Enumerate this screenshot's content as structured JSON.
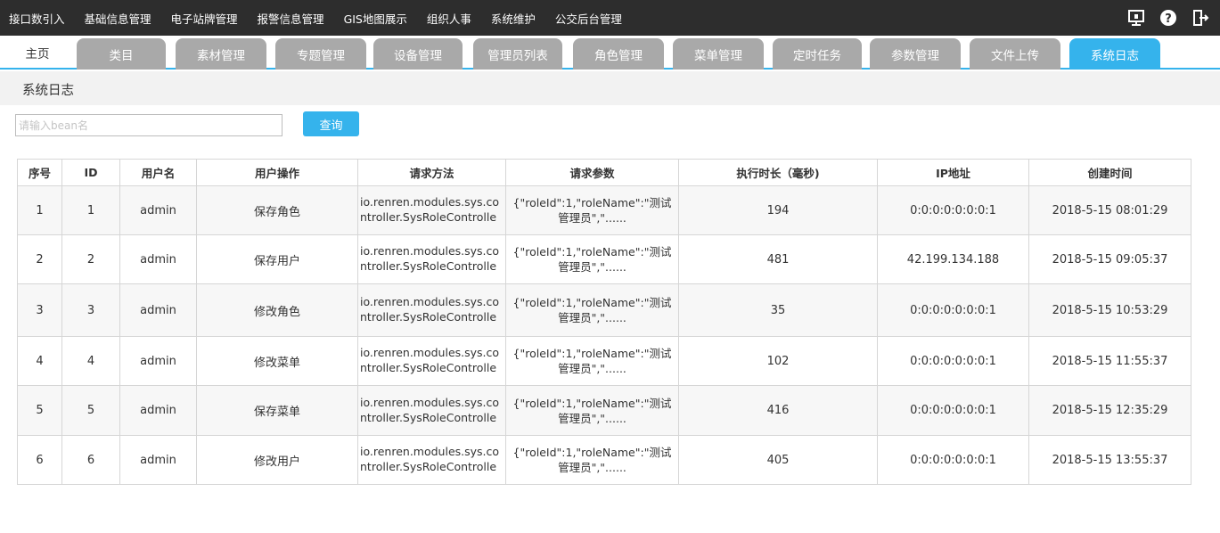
{
  "topmenu": [
    "接口数引入",
    "基础信息管理",
    "电子站牌管理",
    "报警信息管理",
    "GIS地图展示",
    "组织人事",
    "系统维护",
    "公交后台管理"
  ],
  "topicons": {
    "monitor": "monitor-icon",
    "help": "help-icon",
    "logout": "logout-icon"
  },
  "tabs": {
    "home": "主页",
    "items": [
      "类目",
      "素材管理",
      "专题管理",
      "设备管理",
      "管理员列表",
      "角色管理",
      "菜单管理",
      "定时任务",
      "参数管理",
      "文件上传",
      "系统日志"
    ],
    "active_index": 10
  },
  "page": {
    "title": "系统日志"
  },
  "search": {
    "placeholder": "请输入bean名",
    "button": "查询"
  },
  "table": {
    "headers": [
      "序号",
      "ID",
      "用户名",
      "用户操作",
      "请求方法",
      "请求参数",
      "执行时长（毫秒)",
      "IP地址",
      "创建时间"
    ],
    "rows": [
      {
        "no": "1",
        "id": "1",
        "user": "admin",
        "op": "保存角色",
        "method": "io.renren.modules.sys.controller.SysRoleController...",
        "params": "{\"roleId\":1,\"roleName\":\"测试管理员\",\"......",
        "duration": "194",
        "ip": "0:0:0:0:0:0:0:1",
        "time": "2018-5-15 08:01:29"
      },
      {
        "no": "2",
        "id": "2",
        "user": "admin",
        "op": "保存用户",
        "method": "io.renren.modules.sys.controller.SysRoleController...",
        "params": "{\"roleId\":1,\"roleName\":\"测试管理员\",\"......",
        "duration": "481",
        "ip": "42.199.134.188",
        "time": "2018-5-15 09:05:37"
      },
      {
        "no": "3",
        "id": "3",
        "user": "admin",
        "op": "修改角色",
        "method": "io.renren.modules.sys.controller.SysRoleController...",
        "params": "{\"roleId\":1,\"roleName\":\"测试管理员\",\"......",
        "duration": "35",
        "ip": "0:0:0:0:0:0:0:1",
        "time": "2018-5-15 10:53:29"
      },
      {
        "no": "4",
        "id": "4",
        "user": "admin",
        "op": "修改菜单",
        "method": "io.renren.modules.sys.controller.SysRoleController...",
        "params": "{\"roleId\":1,\"roleName\":\"测试管理员\",\"......",
        "duration": "102",
        "ip": "0:0:0:0:0:0:0:1",
        "time": "2018-5-15 11:55:37"
      },
      {
        "no": "5",
        "id": "5",
        "user": "admin",
        "op": "保存菜单",
        "method": "io.renren.modules.sys.controller.SysRoleController...",
        "params": "{\"roleId\":1,\"roleName\":\"测试管理员\",\"......",
        "duration": "416",
        "ip": "0:0:0:0:0:0:0:1",
        "time": "2018-5-15 12:35:29"
      },
      {
        "no": "6",
        "id": "6",
        "user": "admin",
        "op": "修改用户",
        "method": "io.renren.modules.sys.controller.SysRoleController...",
        "params": "{\"roleId\":1,\"roleName\":\"测试管理员\",\"......",
        "duration": "405",
        "ip": "0:0:0:0:0:0:0:1",
        "time": "2018-5-15 13:55:37"
      }
    ]
  },
  "colors": {
    "accent": "#35b3ec",
    "topbar": "#2d2d2d",
    "tab_inactive": "#a9a9a9"
  }
}
